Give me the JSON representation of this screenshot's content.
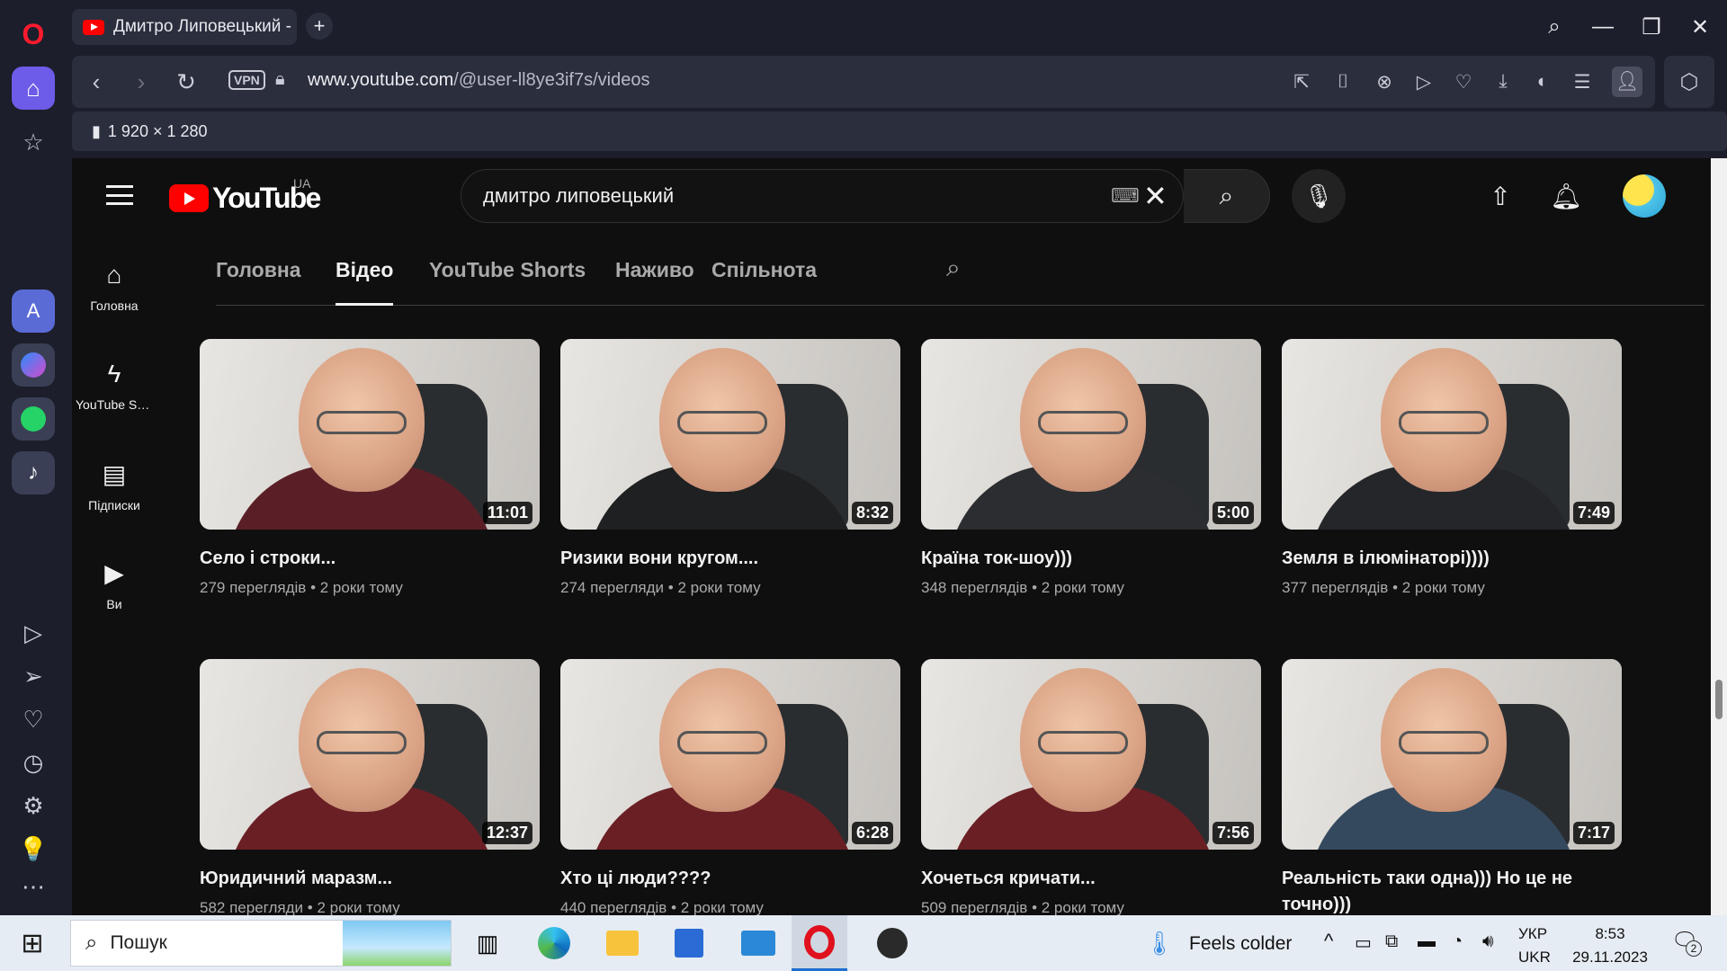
{
  "browser": {
    "tab_title": "Дмитро Липовецький - YouTube",
    "new_tab_symbol": "+",
    "vpn_label": "VPN",
    "url_host": "www.youtube.com",
    "url_path": "/@user-ll8ye3if7s/videos",
    "info_dimensions": "1 920 × 1 280",
    "sidebar_icons": [
      "opera-logo",
      "home-icon",
      "star-icon",
      "aria-icon",
      "messenger-icon",
      "whatsapp-icon",
      "tiktok-icon",
      "player-icon",
      "send-icon",
      "heart-icon",
      "history-icon",
      "settings-icon",
      "tips-icon",
      "more-icon"
    ],
    "accent": "#6c5ce7"
  },
  "youtube": {
    "logo_text": "YouTube",
    "country_code": "UA",
    "search_value": "дмитро липовецький",
    "mini_guide": [
      {
        "label": "Головна",
        "icon": "home-icon"
      },
      {
        "label": "YouTube Shorts",
        "icon": "shorts-icon"
      },
      {
        "label": "Підписки",
        "icon": "subscriptions-icon"
      },
      {
        "label": "Ви",
        "icon": "you-icon"
      }
    ],
    "tabs": [
      "Головна",
      "Відео",
      "YouTube Shorts",
      "Наживо",
      "Спільнота"
    ],
    "active_tab": "Відео",
    "videos": [
      {
        "title": "Село і строки...",
        "views": "279 переглядів",
        "age": "2 роки тому",
        "duration": "11:01",
        "shirt": "#5a1f26"
      },
      {
        "title": "Ризики вони кругом....",
        "views": "274 перегляди",
        "age": "2 роки тому",
        "duration": "8:32",
        "shirt": "#1e2021"
      },
      {
        "title": "Країна ток-шоу)))",
        "views": "348 переглядів",
        "age": "2 роки тому",
        "duration": "5:00",
        "shirt": "#2b2d31"
      },
      {
        "title": "Земля в ілюмінаторі))))",
        "views": "377 переглядів",
        "age": "2 роки тому",
        "duration": "7:49",
        "shirt": "#24262a"
      },
      {
        "title": "Юридичний маразм...",
        "views": "582 перегляди",
        "age": "2 роки тому",
        "duration": "12:37",
        "shirt": "#6a1f24"
      },
      {
        "title": "Хто ці люди????",
        "views": "440 переглядів",
        "age": "2 роки тому",
        "duration": "6:28",
        "shirt": "#6a1f24"
      },
      {
        "title": "Хочеться кричати...",
        "views": "509 переглядів",
        "age": "2 роки тому",
        "duration": "7:56",
        "shirt": "#6a1f24"
      },
      {
        "title": "Реальність таки одна))) Но це не точно)))",
        "views": "",
        "age": "",
        "duration": "7:17",
        "shirt": "#34495e"
      }
    ]
  },
  "taskbar": {
    "search_placeholder": "Пошук",
    "weather": "Feels colder",
    "lang_top": "УКР",
    "lang_bottom": "UKR",
    "time": "8:53",
    "date": "29.11.2023",
    "notifications": "2"
  }
}
